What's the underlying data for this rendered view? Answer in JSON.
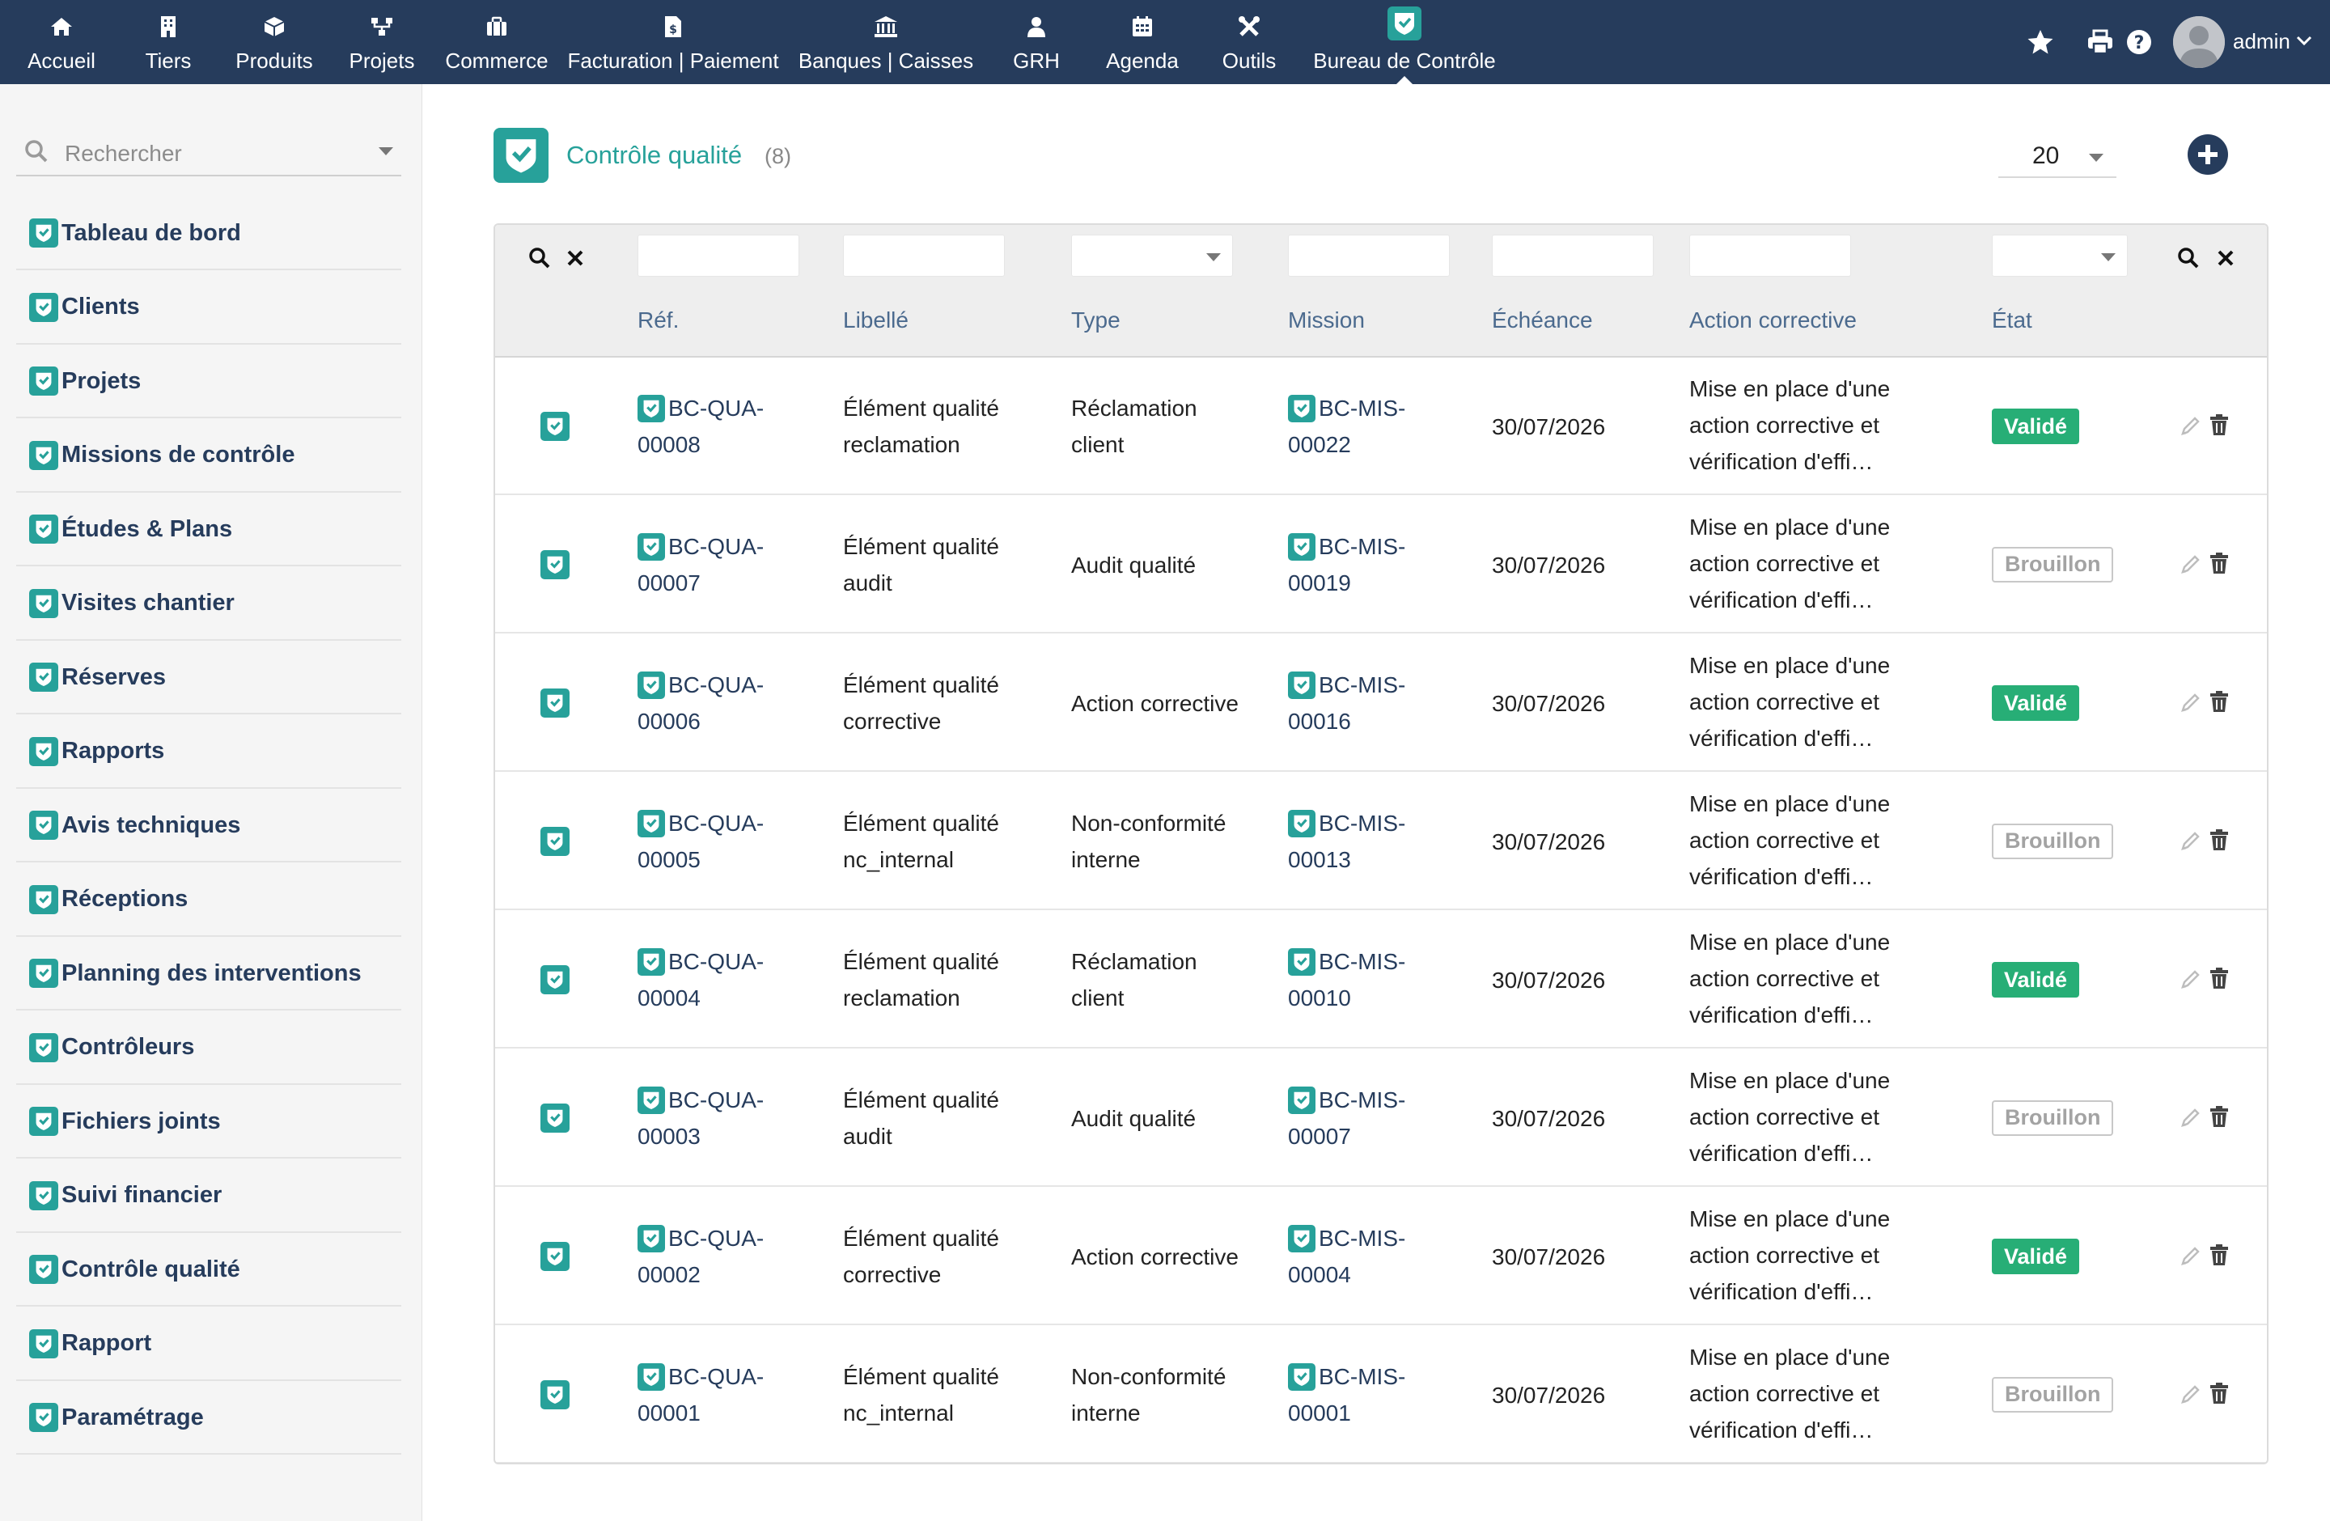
{
  "topnav": {
    "items": [
      {
        "label": "Accueil",
        "icon": "home-icon"
      },
      {
        "label": "Tiers",
        "icon": "building-icon"
      },
      {
        "label": "Produits",
        "icon": "cube-icon"
      },
      {
        "label": "Projets",
        "icon": "sitemap-icon"
      },
      {
        "label": "Commerce",
        "icon": "briefcase-icon"
      },
      {
        "label": "Facturation | Paiement",
        "icon": "invoice-icon"
      },
      {
        "label": "Banques | Caisses",
        "icon": "bank-icon"
      },
      {
        "label": "GRH",
        "icon": "users-icon"
      },
      {
        "label": "Agenda",
        "icon": "calendar-icon"
      },
      {
        "label": "Outils",
        "icon": "tools-icon"
      },
      {
        "label": "Bureau de Contrôle",
        "icon": "shield-check-icon",
        "active": true
      }
    ],
    "user": "admin"
  },
  "sidebar": {
    "search_placeholder": "Rechercher",
    "items": [
      {
        "label": "Tableau de bord"
      },
      {
        "label": "Clients"
      },
      {
        "label": "Projets"
      },
      {
        "label": "Missions de contrôle"
      },
      {
        "label": "Études & Plans"
      },
      {
        "label": "Visites chantier"
      },
      {
        "label": "Réserves"
      },
      {
        "label": "Rapports"
      },
      {
        "label": "Avis techniques"
      },
      {
        "label": "Réceptions"
      },
      {
        "label": "Planning des interventions"
      },
      {
        "label": "Contrôleurs"
      },
      {
        "label": "Fichiers joints"
      },
      {
        "label": "Suivi financier"
      },
      {
        "label": "Contrôle qualité"
      },
      {
        "label": "Rapport"
      },
      {
        "label": "Paramétrage"
      }
    ]
  },
  "page": {
    "title": "Contrôle qualité",
    "count": "(8)",
    "per_page": "20"
  },
  "table": {
    "columns": [
      "Réf.",
      "Libellé",
      "Type",
      "Mission",
      "Échéance",
      "Action corrective",
      "État"
    ],
    "rows": [
      {
        "ref1": "BC-QUA-",
        "ref2": "00008",
        "lib1": "Élément qualité",
        "lib2": "reclamation",
        "type1": "Réclamation",
        "type2": "client",
        "mis1": "BC-MIS-",
        "mis2": "00022",
        "date": "30/07/2026",
        "act1": "Mise en place d'une",
        "act2": "action corrective et",
        "act3": "vérification d'effi…",
        "state": "Validé",
        "state_kind": "valid"
      },
      {
        "ref1": "BC-QUA-",
        "ref2": "00007",
        "lib1": "Élément qualité",
        "lib2": "audit",
        "type1": "Audit qualité",
        "type2": "",
        "mis1": "BC-MIS-",
        "mis2": "00019",
        "date": "30/07/2026",
        "act1": "Mise en place d'une",
        "act2": "action corrective et",
        "act3": "vérification d'effi…",
        "state": "Brouillon",
        "state_kind": "draft"
      },
      {
        "ref1": "BC-QUA-",
        "ref2": "00006",
        "lib1": "Élément qualité",
        "lib2": "corrective",
        "type1": "Action corrective",
        "type2": "",
        "mis1": "BC-MIS-",
        "mis2": "00016",
        "date": "30/07/2026",
        "act1": "Mise en place d'une",
        "act2": "action corrective et",
        "act3": "vérification d'effi…",
        "state": "Validé",
        "state_kind": "valid"
      },
      {
        "ref1": "BC-QUA-",
        "ref2": "00005",
        "lib1": "Élément qualité",
        "lib2": "nc_internal",
        "type1": "Non-conformité",
        "type2": "interne",
        "mis1": "BC-MIS-",
        "mis2": "00013",
        "date": "30/07/2026",
        "act1": "Mise en place d'une",
        "act2": "action corrective et",
        "act3": "vérification d'effi…",
        "state": "Brouillon",
        "state_kind": "draft"
      },
      {
        "ref1": "BC-QUA-",
        "ref2": "00004",
        "lib1": "Élément qualité",
        "lib2": "reclamation",
        "type1": "Réclamation",
        "type2": "client",
        "mis1": "BC-MIS-",
        "mis2": "00010",
        "date": "30/07/2026",
        "act1": "Mise en place d'une",
        "act2": "action corrective et",
        "act3": "vérification d'effi…",
        "state": "Validé",
        "state_kind": "valid"
      },
      {
        "ref1": "BC-QUA-",
        "ref2": "00003",
        "lib1": "Élément qualité",
        "lib2": "audit",
        "type1": "Audit qualité",
        "type2": "",
        "mis1": "BC-MIS-",
        "mis2": "00007",
        "date": "30/07/2026",
        "act1": "Mise en place d'une",
        "act2": "action corrective et",
        "act3": "vérification d'effi…",
        "state": "Brouillon",
        "state_kind": "draft"
      },
      {
        "ref1": "BC-QUA-",
        "ref2": "00002",
        "lib1": "Élément qualité",
        "lib2": "corrective",
        "type1": "Action corrective",
        "type2": "",
        "mis1": "BC-MIS-",
        "mis2": "00004",
        "date": "30/07/2026",
        "act1": "Mise en place d'une",
        "act2": "action corrective et",
        "act3": "vérification d'effi…",
        "state": "Validé",
        "state_kind": "valid"
      },
      {
        "ref1": "BC-QUA-",
        "ref2": "00001",
        "lib1": "Élément qualité",
        "lib2": "nc_internal",
        "type1": "Non-conformité",
        "type2": "interne",
        "mis1": "BC-MIS-",
        "mis2": "00001",
        "date": "30/07/2026",
        "act1": "Mise en place d'une",
        "act2": "action corrective et",
        "act3": "vérification d'effi…",
        "state": "Brouillon",
        "state_kind": "draft"
      }
    ]
  },
  "colors": {
    "nav_bg": "#263c5c",
    "accent": "#27a19a",
    "valid": "#27ae76",
    "link": "#263c5c"
  }
}
